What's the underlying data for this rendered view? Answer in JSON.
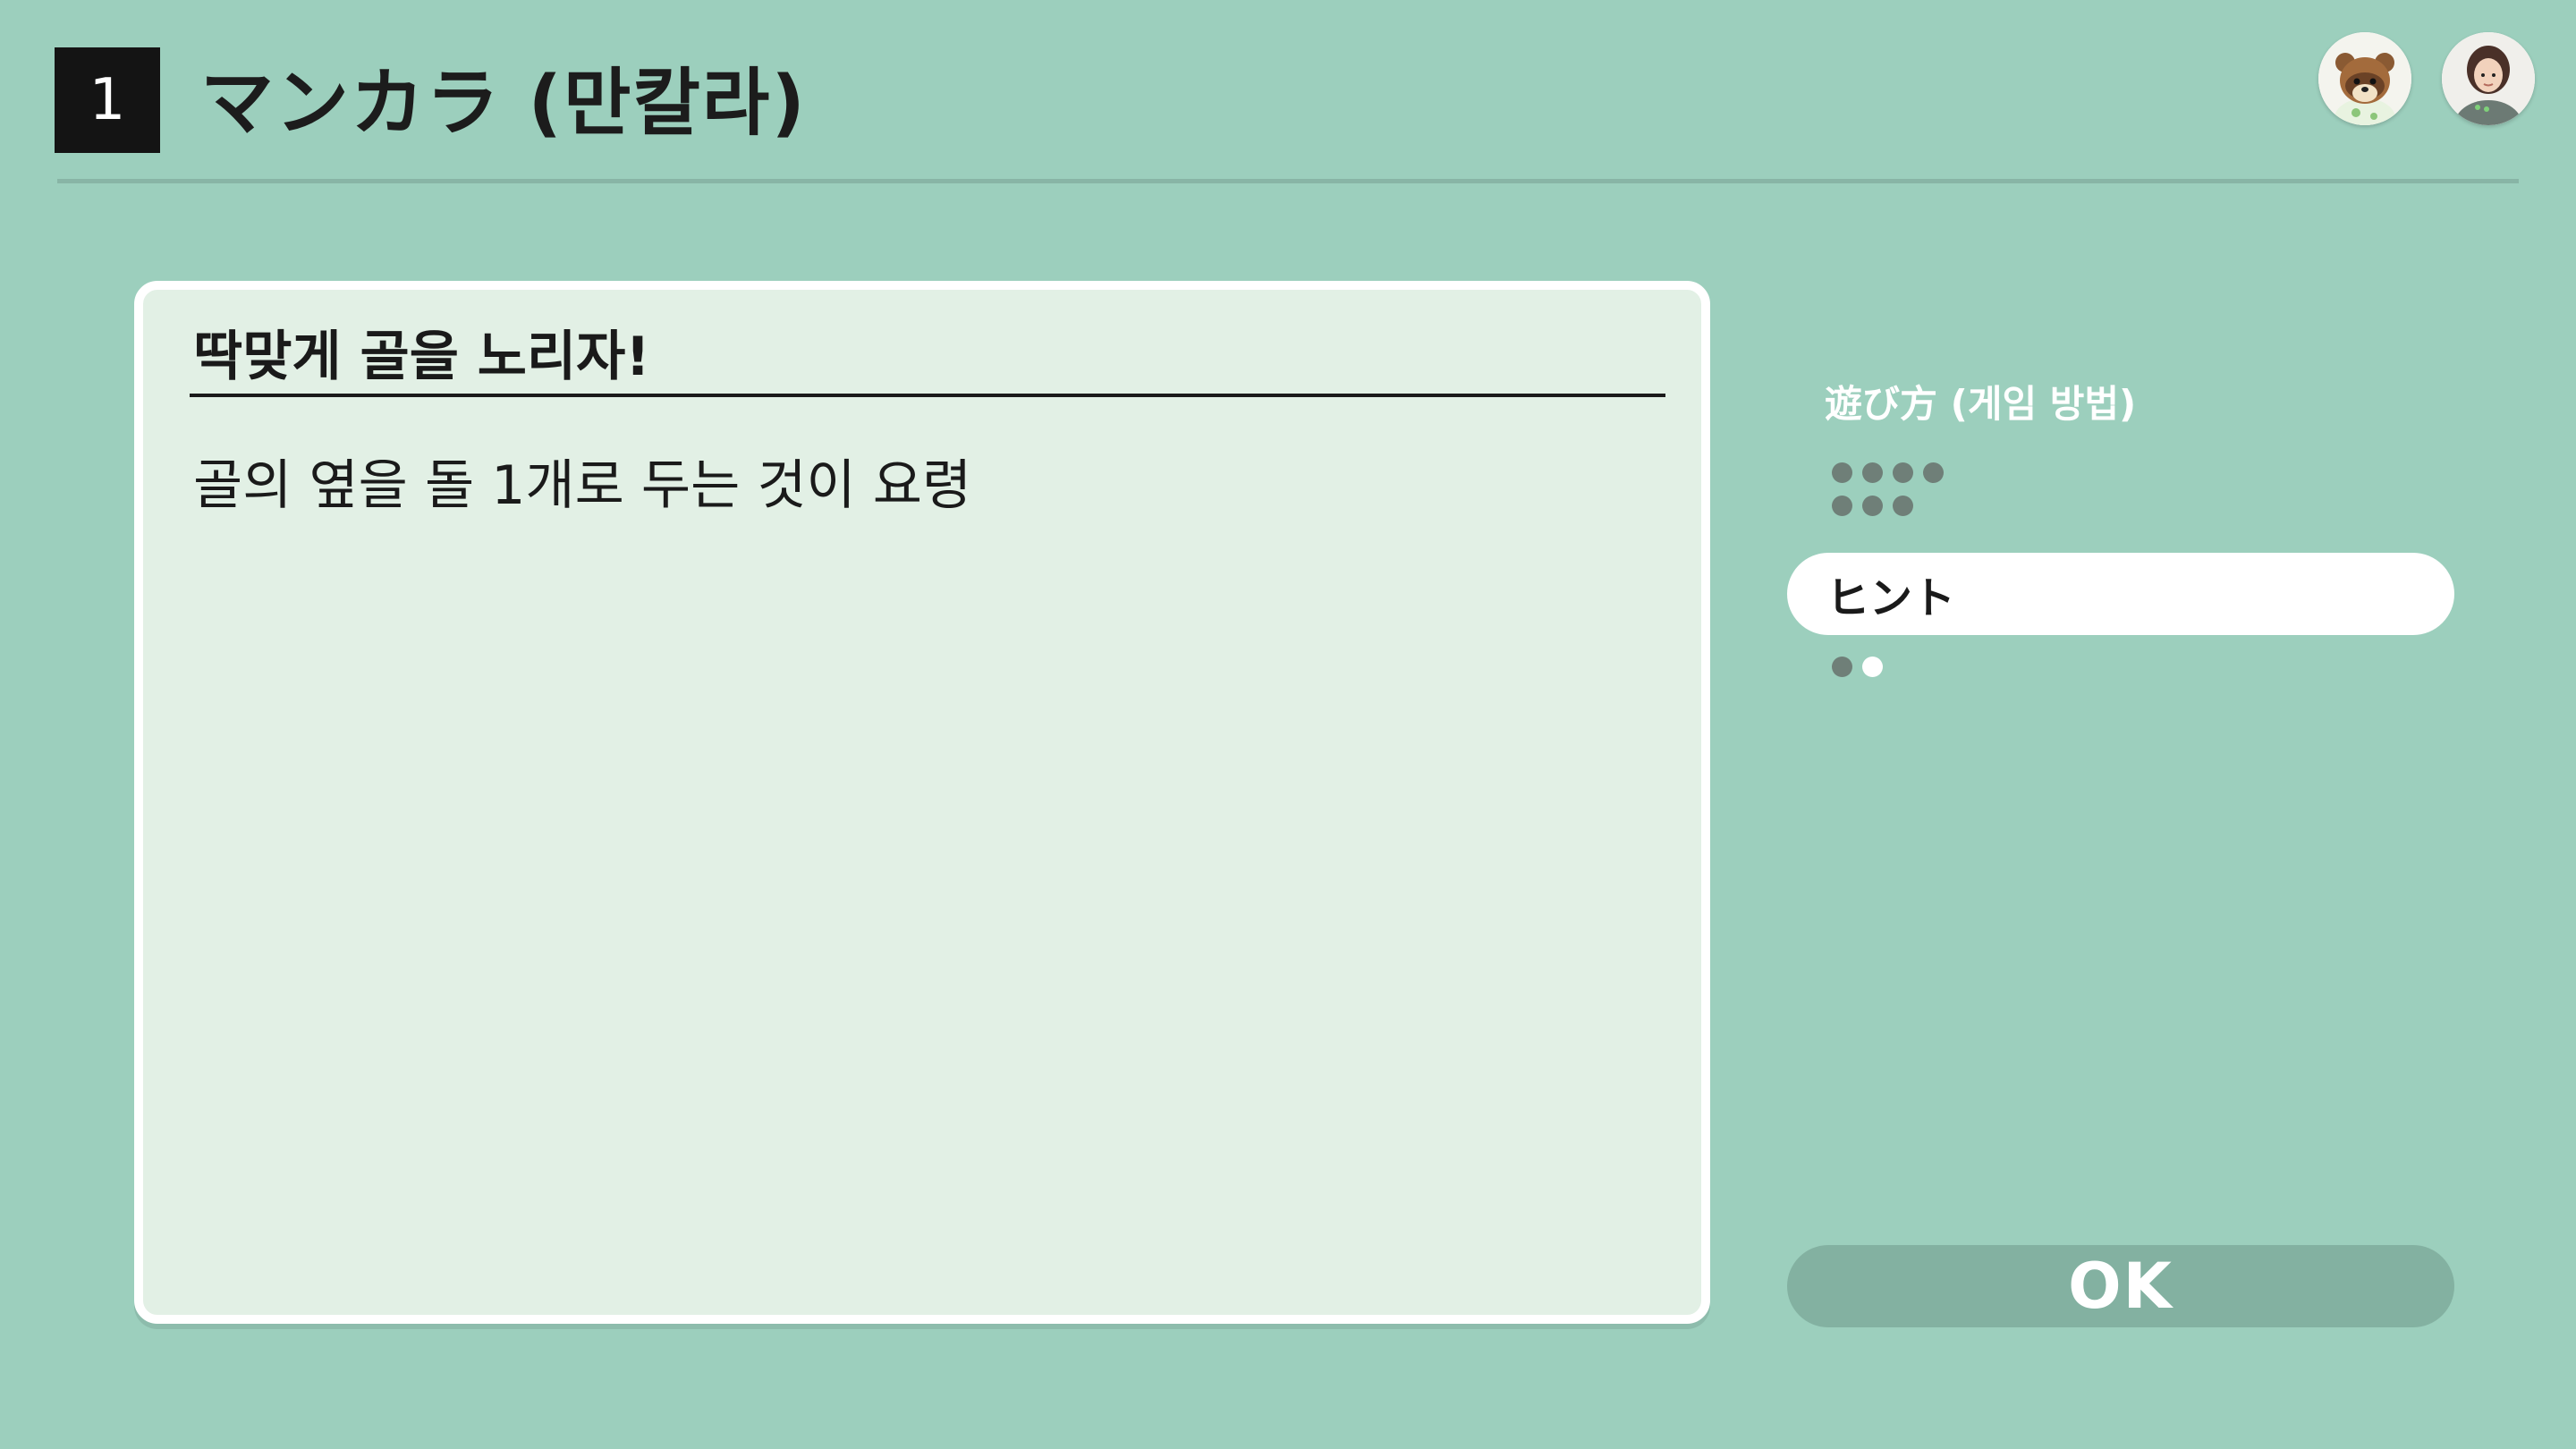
{
  "header": {
    "number": "1",
    "title": "マンカラ (만칼라)"
  },
  "avatars": [
    {
      "icon": "raccoon-character-icon"
    },
    {
      "icon": "player-portrait-icon"
    }
  ],
  "card": {
    "title": "딱맞게 골을 노리자!",
    "body": "골의 옆을 돌 1개로 두는 것이 요령"
  },
  "side_menu": {
    "section_label": "遊び方 (게임 방법)",
    "section_dots": 7,
    "selected_item_label": "ヒント",
    "selected_item_dots": 2,
    "selected_item_active_dot": 2
  },
  "ok_button": {
    "label": "OK"
  },
  "colors": {
    "background": "#9ccfbd",
    "card": "#e2f0e5",
    "dot_inactive": "#6f7f78",
    "ok_button": "#83b1a1"
  }
}
